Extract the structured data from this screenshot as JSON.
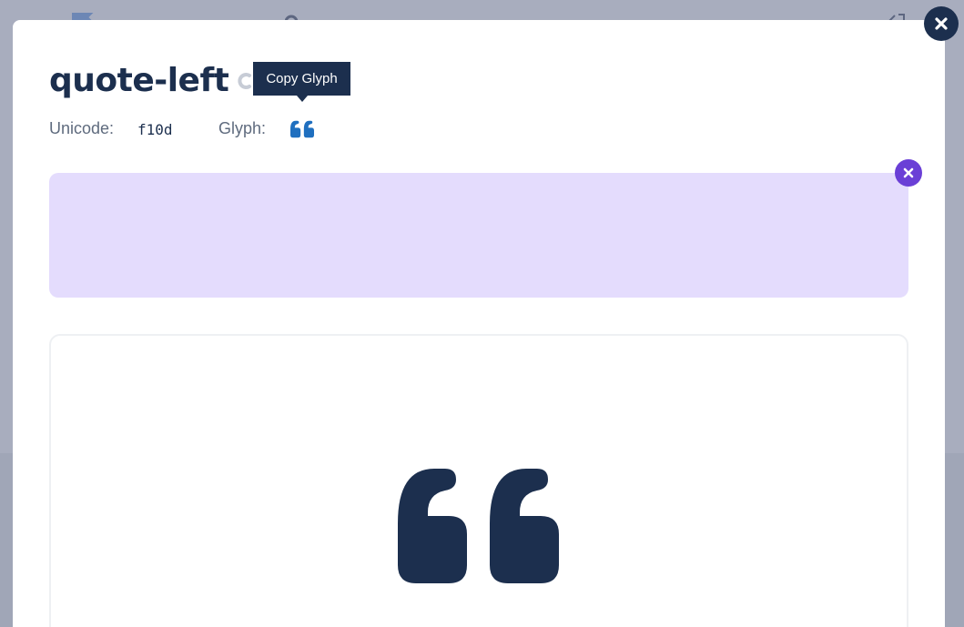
{
  "modal": {
    "icon_name": "quote-left",
    "tooltip": "Copy Glyph",
    "unicode_label": "Unicode:",
    "unicode_value": "f10d",
    "glyph_label": "Glyph:",
    "glyph_icon": "quote-left-icon",
    "preview_icon": "quote-left-icon"
  },
  "colors": {
    "navy": "#1c2f4e",
    "glyph_blue": "#1f6fbf",
    "ad_background": "#e4dcfd",
    "ad_close": "#6a3fd6",
    "backdrop": "#a8adbe"
  }
}
